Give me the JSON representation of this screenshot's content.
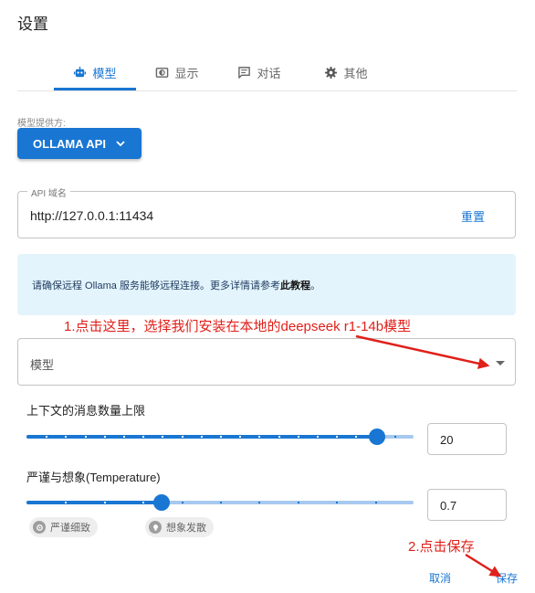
{
  "window": {
    "title": "设置"
  },
  "tabs": [
    {
      "label": "模型",
      "icon": "robot-icon",
      "active": true
    },
    {
      "label": "显示",
      "icon": "display-icon",
      "active": false
    },
    {
      "label": "对话",
      "icon": "chat-icon",
      "active": false
    },
    {
      "label": "其他",
      "icon": "gear-icon",
      "active": false
    }
  ],
  "provider": {
    "label": "模型提供方:",
    "value": "OLLAMA API"
  },
  "api": {
    "legend": "API 域名",
    "value": "http://127.0.0.1:11434",
    "reset_label": "重置"
  },
  "info": {
    "text": "请确保远程 Ollama 服务能够远程连接。更多详情请参考",
    "link": "此教程",
    "suffix": "。"
  },
  "model": {
    "placeholder": "模型"
  },
  "context": {
    "label": "上下文的消息数量上限",
    "value": "20",
    "slider_fraction": 0.905
  },
  "temperature": {
    "label": "严谨与想象(Temperature)",
    "value": "0.7",
    "slider_fraction": 0.35,
    "chip_strict": "严谨细致",
    "chip_creative": "想象发散"
  },
  "actions": {
    "cancel": "取消",
    "save": "保存"
  },
  "annotations": {
    "step1": "1.点击这里，选择我们安装在本地的deepseek r1-14b模型",
    "step2": "2.点击保存"
  },
  "colors": {
    "accent": "#1976d2",
    "info_bg": "#e3f4fc",
    "annotation": "#e0201a"
  }
}
